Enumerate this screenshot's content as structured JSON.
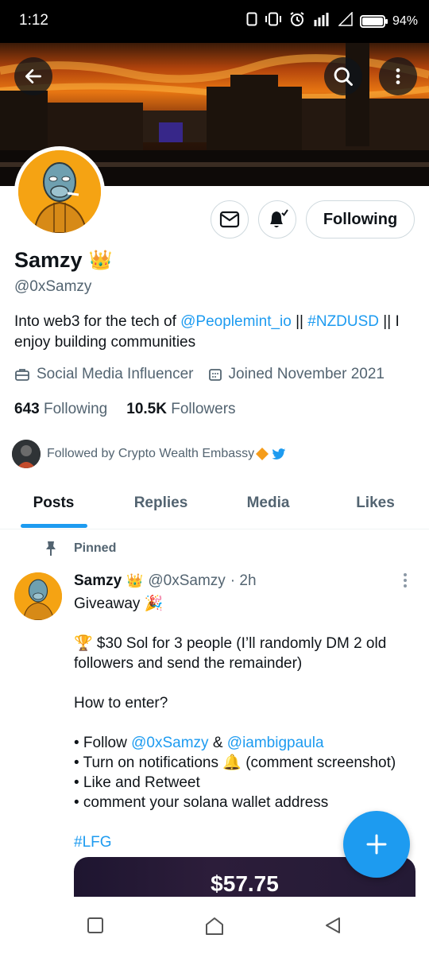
{
  "status_bar": {
    "time": "1:12",
    "battery": "94%"
  },
  "profile": {
    "name": "Samzy",
    "name_emoji": "👑",
    "handle": "@0xSamzy",
    "bio": {
      "prefix": "Into web3 for the tech of ",
      "mention": "@Peoplemint_io",
      "separator1": " || ",
      "hashtag": "#NZDUSD",
      "suffix": " || I enjoy building communities"
    },
    "category": "Social Media Influencer",
    "joined": "Joined November 2021",
    "following_count": "643",
    "following_label": "Following",
    "followers_count": "10.5K",
    "followers_label": "Followers",
    "followed_by": "Followed by Crypto Wealth Embassy"
  },
  "actions": {
    "following_button": "Following"
  },
  "tabs": [
    {
      "label": "Posts",
      "active": true
    },
    {
      "label": "Replies",
      "active": false
    },
    {
      "label": "Media",
      "active": false
    },
    {
      "label": "Likes",
      "active": false
    }
  ],
  "tweet": {
    "pinned_label": "Pinned",
    "author_name": "Samzy",
    "author_emoji": "👑",
    "author_handle": "@0xSamzy",
    "time": "· 2h",
    "line1": "Giveaway 🎉",
    "line2": "🏆 $30 Sol for 3 people (I’ll randomly DM 2 old followers and send the remainder)",
    "line3": "How to enter?",
    "bullet1_prefix": "• Follow ",
    "bullet1_mention1": "@0xSamzy",
    "bullet1_amp": " & ",
    "bullet1_mention2": "@iambigpaula",
    "bullet2": "• Turn on notifications 🔔 (comment screenshot)",
    "bullet3": "• Like and Retweet",
    "bullet4": "•  comment your solana wallet address",
    "hashtag": "#LFG",
    "media_price": "$57.75"
  },
  "colors": {
    "accent": "#1d9bf0",
    "avatar_bg": "#f5a313",
    "muted": "#536471"
  }
}
